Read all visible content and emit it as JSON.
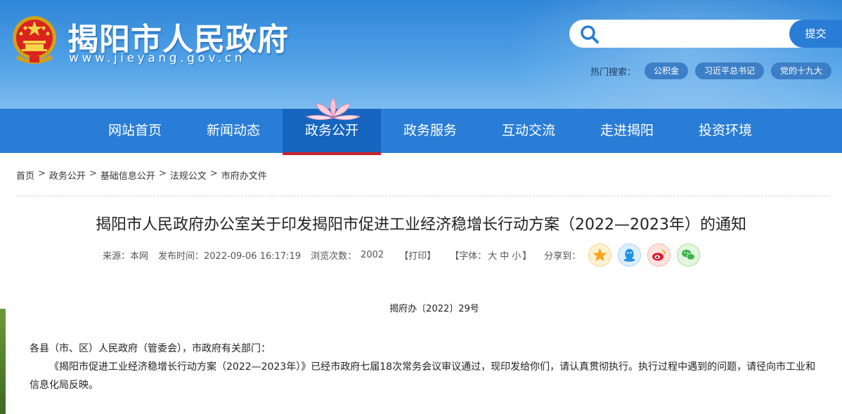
{
  "header": {
    "site_title": "揭阳市人民政府",
    "site_domain": "www.jieyang.gov.cn",
    "search": {
      "placeholder": "",
      "button_label": "提交"
    },
    "hot_search": {
      "label": "热门搜索：",
      "tags": [
        "公积金",
        "习近平总书记",
        "党的十九大"
      ]
    }
  },
  "nav": {
    "items": [
      "网站首页",
      "新闻动态",
      "政务公开",
      "政务服务",
      "互动交流",
      "走进揭阳",
      "投资环境"
    ],
    "active": "政务公开"
  },
  "breadcrumb": {
    "items": [
      "首页",
      "政务公开",
      "基础信息公开",
      "法规公文",
      "市府办文件"
    ],
    "separator": ">"
  },
  "article": {
    "title": "揭阳市人民政府办公室关于印发揭阳市促进工业经济稳增长行动方案（2022—2023年）的通知",
    "meta": {
      "source": "来源：本网",
      "publish_time": "发布时间：2022-09-06 16:17:19",
      "views_label": "浏览次数：",
      "views": "2002",
      "print": "【打印】",
      "font_open": "【字体：",
      "font_large": "大",
      "font_medium": "中",
      "font_small": "小",
      "font_close": "】",
      "share_label": "分享到：",
      "share_icons": [
        "star-icon",
        "qq-icon",
        "weibo-icon",
        "wechat-icon"
      ]
    },
    "doc_number": "揭府办〔2022〕29号",
    "salutation": "各县（市、区）人民政府（管委会），市政府有关部门：",
    "paragraph": "《揭阳市促进工业经济稳增长行动方案（2022—2023年）》已经市政府七届18次常务会议审议通过，现印发给你们，请认真贯彻执行。执行过程中遇到的问题，请径向市工业和信息化局反映。"
  },
  "colors": {
    "header_blue": "#4fa0e6",
    "nav_blue": "#2a7dd6",
    "nav_active": "#1666c0",
    "active_underline": "#d0202a",
    "tag_blue": "#3d7fc6"
  }
}
